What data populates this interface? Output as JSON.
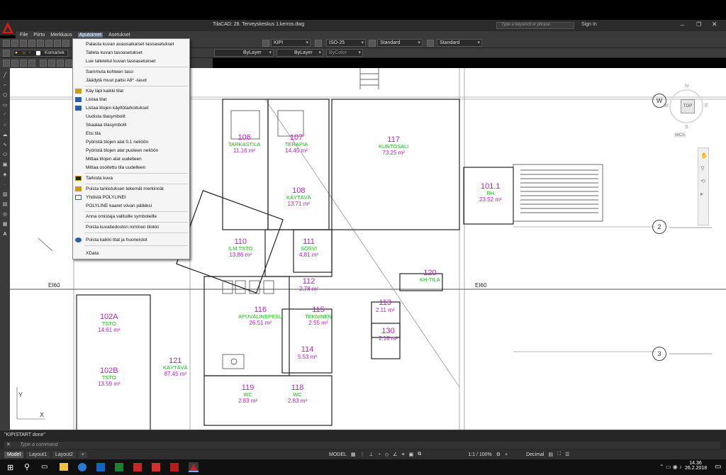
{
  "window": {
    "title": "TilaCAD:   28. Terveyskeskus 1.kerros.dwg",
    "search_placeholder": "Type a keyword or phrase",
    "sign_in": "Sign In"
  },
  "menubar": {
    "items": [
      "File",
      "Piirto",
      "Merkkaus",
      "Aputoimet",
      "Asetukset"
    ],
    "active": "Aputoimet"
  },
  "toolbar": {
    "layer_name": "Komartek",
    "bylayer_linetype": "ByLayer",
    "bylayer_lineweight": "ByLayer",
    "bycolor": "ByColor",
    "text_style": "KIPI",
    "dim_style": "ISO-25",
    "table_style": "Standard",
    "multileader_style": "Standard"
  },
  "dropdown_menu": {
    "groups": [
      [
        "Palauta kuvan avausaikaiset tasoasetukset",
        "Talleta kuvan tasoasetukset",
        "Lue talletetut kuvan tasoasetukset"
      ],
      [
        "Sammuta kohteen taso",
        "Jäädytä muut paitsi A8* -tasot"
      ],
      [
        "Käy läpi kaikki tilat",
        "Listaa tilat",
        "Listaa tilojen käyttötarkoitukset",
        "Uudista tilasymbolit",
        "Skaalaa tilasymbolit",
        "Etsi tila",
        "Pyöristä tilojen alat 0.1 neliöön",
        "Pyöristä tilojen alat puoleen neliöön",
        "Mittaa tilojen alat uudelleen",
        "Mittaa osoitettu tila uudelleen"
      ],
      [
        "Tarkista kuva"
      ],
      [
        "Poista tarkistuksen tekemät merkinnät",
        "Yhdistä POLYLINEt",
        "POLYLINE kaaret viivan pätkiksi"
      ],
      [
        "Anna omistaja valituille symboleille"
      ],
      [
        "Poista kuvatiedoston niminen blokki"
      ],
      [
        "Poista kaikki tilat ja huoneistot"
      ],
      [
        "XData"
      ]
    ]
  },
  "rooms": [
    {
      "num": "106",
      "name": "TARKASTILA",
      "area": "11.16 m²"
    },
    {
      "num": "107",
      "name": "TERAPIA",
      "area": "14.45 m²"
    },
    {
      "num": "117",
      "name": "KUNTOSALI",
      "area": "73.25 m²"
    },
    {
      "num": "101.1",
      "name": "RH",
      "area": "23.52 m²"
    },
    {
      "num": "108",
      "name": "KÄYTÄVÄ",
      "area": "13.71 m²"
    },
    {
      "num": "110",
      "name": "ILM.TSTO",
      "area": "13.86 m²"
    },
    {
      "num": "111",
      "name": "SOSVI",
      "area": "4.81 m²"
    },
    {
      "num": "112",
      "name": "",
      "area": "2.78 m²"
    },
    {
      "num": "120",
      "name": "KH-TILA",
      "area": ""
    },
    {
      "num": "116",
      "name": "APUVÄLINEPESU",
      "area": "26.51 m²"
    },
    {
      "num": "115",
      "name": "TEKNINEN",
      "area": "2.55 m²"
    },
    {
      "num": "113",
      "name": "",
      "area": "2.11 m²"
    },
    {
      "num": "102A",
      "name": "TSTO",
      "area": "14.61 m²"
    },
    {
      "num": "121",
      "name": "KÄYTÄVÄ",
      "area": "87.45 m²"
    },
    {
      "num": "114",
      "name": "",
      "area": "5.53 m²"
    },
    {
      "num": "130",
      "name": "",
      "area": "2.18 m²"
    },
    {
      "num": "102B",
      "name": "TSTO",
      "area": "13.59 m²"
    },
    {
      "num": "119",
      "name": "WC",
      "area": "2.83 m²"
    },
    {
      "num": "118",
      "name": "WC",
      "area": "2.83 m²"
    }
  ],
  "drawing_labels": {
    "ei60_left": "EI60",
    "ei60_right": "EI60",
    "axis_2": "2",
    "axis_3": "3",
    "axis_w": "W",
    "y_axis": "Y",
    "x_axis": "X"
  },
  "viewcube": {
    "top": "TOP",
    "n": "N",
    "s": "S",
    "e": "E",
    "w": "W",
    "wcs": "WCS"
  },
  "command": {
    "history": "\"KIPISTART done\"",
    "placeholder": "Type a command"
  },
  "layout_tabs": [
    "Model",
    "Layout1",
    "Layout2"
  ],
  "status": {
    "model": "MODEL",
    "scale": "1:1 / 100%",
    "units": "Decimal"
  },
  "taskbar": {
    "time": "14.36",
    "date": "26.2.2018"
  }
}
